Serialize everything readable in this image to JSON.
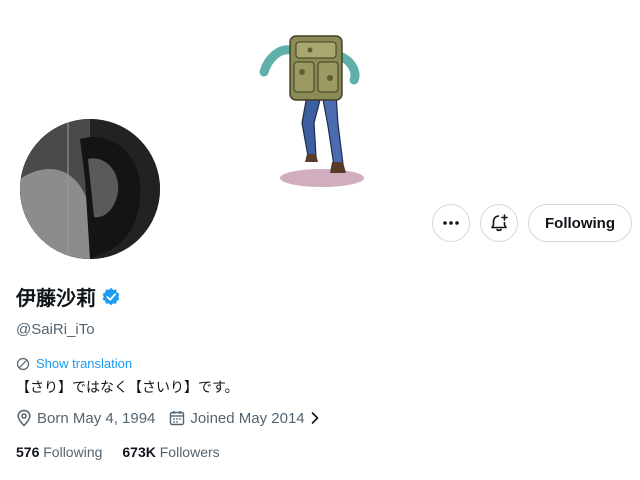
{
  "profile": {
    "display_name": "伊藤沙莉",
    "handle": "@SaiRi_iTo",
    "verified": true,
    "bio": "【さり】ではなく【さいり】です。",
    "show_translation": "Show translation",
    "birth": "Born May 4, 1994",
    "joined": "Joined May 2014"
  },
  "actions": {
    "follow_label": "Following",
    "more_icon": "more-horizontal-icon",
    "notify_icon": "bell-plus-icon"
  },
  "stats": {
    "following_count": "576",
    "following_label": "Following",
    "followers_count": "673K",
    "followers_label": "Followers"
  },
  "colors": {
    "accent": "#1d9bf0",
    "text_primary": "#0f1419",
    "text_secondary": "#536471",
    "border": "#cfd9de"
  }
}
